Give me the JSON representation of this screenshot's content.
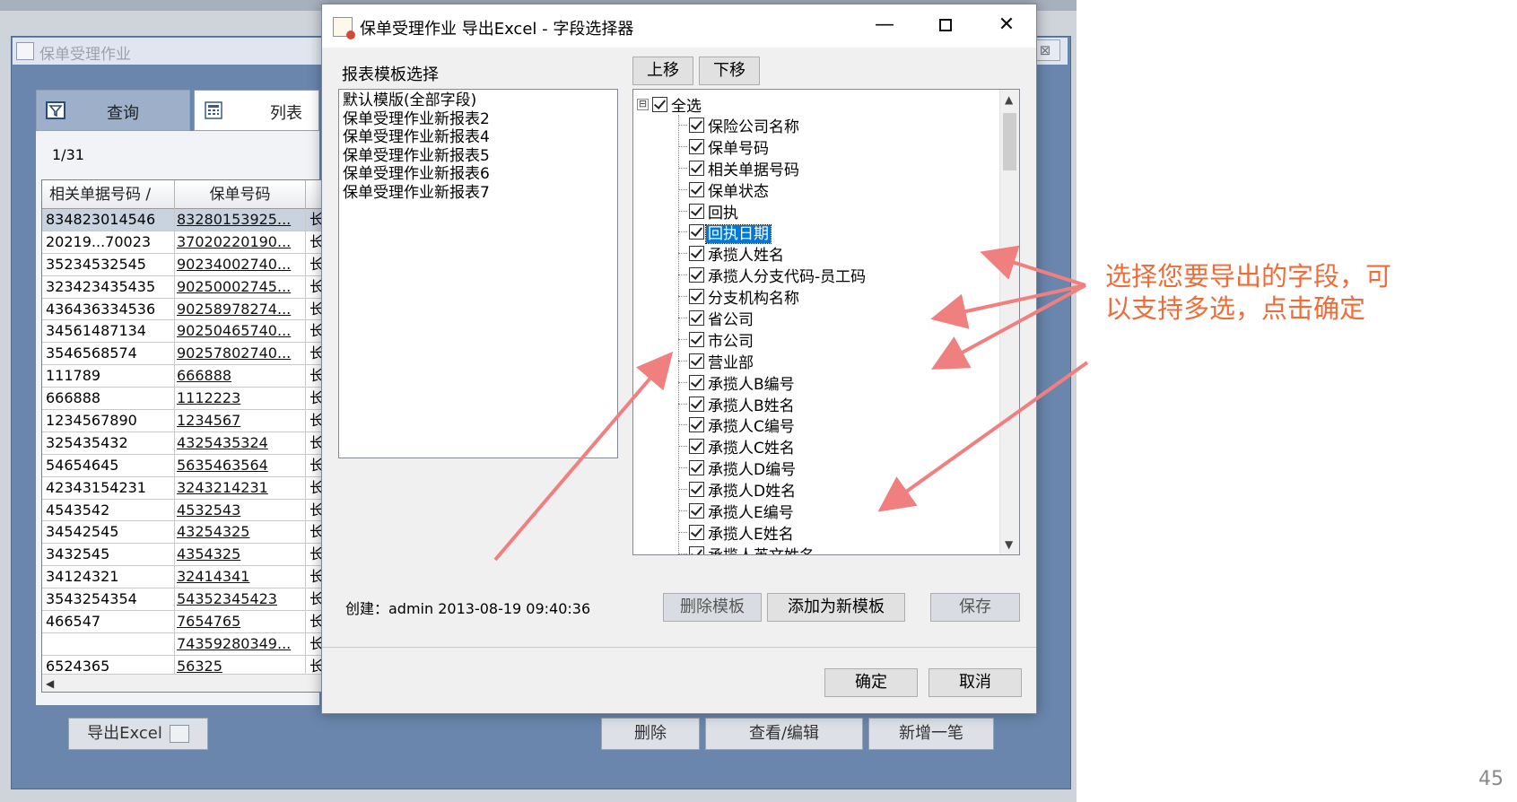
{
  "bg_window": {
    "title": "保单受理作业",
    "close_label": "⊠",
    "tabs": [
      {
        "label": "查询"
      },
      {
        "label": "列表"
      }
    ],
    "page_count": "1/31",
    "grid": {
      "columns": [
        "相关单据号码 /",
        "保单号码",
        ""
      ],
      "rows": [
        [
          "834823014546",
          "83280153925...",
          "长"
        ],
        [
          "20219...70023",
          "37020220190...",
          "长"
        ],
        [
          "35234532545",
          "90234002740...",
          "长"
        ],
        [
          "323423435435",
          "90250002745...",
          "长"
        ],
        [
          "436436334536",
          "90258978274...",
          "长"
        ],
        [
          "34561487134",
          "90250465740...",
          "长"
        ],
        [
          "3546568574",
          "90257802740...",
          "长"
        ],
        [
          "111789",
          "666888",
          "长"
        ],
        [
          "666888",
          "1112223",
          "长"
        ],
        [
          "1234567890",
          "1234567",
          "长"
        ],
        [
          "325435432",
          "4325435324",
          "长"
        ],
        [
          "54654645",
          "5635463564",
          "长"
        ],
        [
          "42343154231",
          "3243214231",
          "长"
        ],
        [
          "4543542",
          "4532543",
          "长"
        ],
        [
          "34542545",
          "43254325",
          "长"
        ],
        [
          "3432545",
          "4354325",
          "长"
        ],
        [
          "34124321",
          "32414341",
          "长"
        ],
        [
          "3543254354",
          "54352345423",
          "长"
        ],
        [
          "466547",
          "7654765",
          "长"
        ],
        [
          "",
          "74359280349...",
          "长"
        ],
        [
          "6524365",
          "56325",
          "长"
        ]
      ]
    },
    "buttons": {
      "export_excel": "导出Excel",
      "delete": "删除",
      "view_edit": "查看/编辑",
      "add_new": "新增一笔"
    }
  },
  "dialog": {
    "title": "保单受理作业 导出Excel - 字段选择器",
    "controls": {
      "minimize": "—",
      "close": "✕"
    },
    "template_label": "报表模板选择",
    "templates": [
      "默认模版(全部字段)",
      "保单受理作业新报表2",
      "保单受理作业新报表4",
      "保单受理作业新报表5",
      "保单受理作业新报表6",
      "保单受理作业新报表7"
    ],
    "move_up": "上移",
    "move_down": "下移",
    "tree": {
      "expander": "⊟",
      "root_label": "全选",
      "items": [
        "保险公司名称",
        "保单号码",
        "相关单据号码",
        "保单状态",
        "回执",
        "回执日期",
        "承揽人姓名",
        "承揽人分支代码-员工码",
        "分支机构名称",
        "省公司",
        "市公司",
        "营业部",
        "承揽人B编号",
        "承揽人B姓名",
        "承揽人C编号",
        "承揽人C姓名",
        "承揽人D编号",
        "承揽人D姓名",
        "承揽人E编号",
        "承揽人E姓名",
        "承揽人英文姓名"
      ],
      "selected_item": "回执日期"
    },
    "created": "创建：admin  2013-08-19 09:40:36",
    "buttons": {
      "delete_template": "删除模板",
      "add_template": "添加为新模板",
      "save": "保存",
      "ok": "确定",
      "cancel": "取消"
    }
  },
  "annotation": {
    "text": "选择您要导出的字段，可以支持多选，点击确定",
    "color": "#ef6c38"
  },
  "page_number": "45",
  "colors": {
    "arrow": "#f08080",
    "selection": "#0078d7",
    "bg_frame": "#6a86ad"
  }
}
